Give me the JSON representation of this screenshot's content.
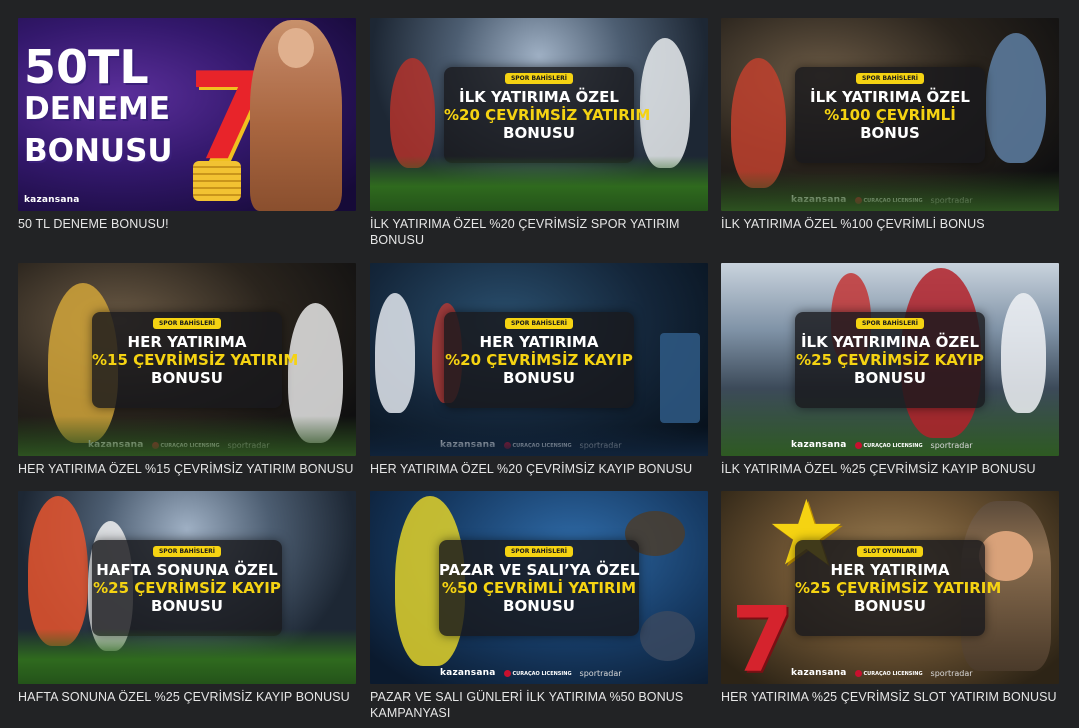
{
  "cards": [
    {
      "caption": "50 TL DENEME BONUSU!",
      "banner": {
        "style": "casino",
        "big_lines": [
          "50TL",
          "DENEME",
          "BONUSU"
        ],
        "footer_brand": "kazansana"
      }
    },
    {
      "caption": "İLK YATIRIMA ÖZEL %20 ÇEVRİMSİZ SPOR YATIRIM BONUSU",
      "banner": {
        "style": "sport",
        "tag": "SPOR BAHİSLERİ",
        "lines": [
          "İLK YATIRIMA ÖZEL",
          "%20 ÇEVRİMSİZ YATIRIM",
          "BONUSU"
        ],
        "footer_brand": "kazansana",
        "footer_license": "CURAÇAO LICENSING",
        "footer_partner": "sportradar"
      }
    },
    {
      "caption": "İLK YATIRIMA ÖZEL %100 ÇEVRİMLİ BONUS",
      "banner": {
        "style": "sport",
        "tag": "SPOR BAHİSLERİ",
        "lines": [
          "İLK YATIRIMA ÖZEL",
          "%100 ÇEVRİMLİ",
          "BONUS"
        ],
        "footer_brand": "kazansana",
        "footer_license": "CURAÇAO LICENSING",
        "footer_partner": "sportradar"
      }
    },
    {
      "caption": "HER YATIRIMA ÖZEL %15 ÇEVRİMSİZ YATIRIM BONUSU",
      "banner": {
        "style": "sport",
        "tag": "SPOR BAHİSLERİ",
        "lines": [
          "HER YATIRIMA",
          "%15 ÇEVRİMSİZ YATIRIM",
          "BONUSU"
        ],
        "footer_brand": "kazansana",
        "footer_license": "CURAÇAO LICENSING",
        "footer_partner": "sportradar"
      }
    },
    {
      "caption": "HER YATIRIMA ÖZEL %20 ÇEVRİMSİZ KAYIP BONUSU",
      "banner": {
        "style": "sport",
        "tag": "SPOR BAHİSLERİ",
        "lines": [
          "HER YATIRIMA",
          "%20 ÇEVRİMSİZ KAYIP",
          "BONUSU"
        ],
        "footer_brand": "kazansana",
        "footer_license": "CURAÇAO LICENSING",
        "footer_partner": "sportradar"
      }
    },
    {
      "caption": "İLK YATIRIMA ÖZEL %25 ÇEVRİMSİZ KAYIP BONUSU",
      "banner": {
        "style": "sport",
        "tag": "SPOR BAHİSLERİ",
        "lines": [
          "İLK YATIRIMINA ÖZEL",
          "%25 ÇEVRİMSİZ KAYIP",
          "BONUSU"
        ],
        "footer_brand": "kazansana",
        "footer_license": "CURAÇAO LICENSING",
        "footer_partner": "sportradar"
      }
    },
    {
      "caption": "HAFTA SONUNA ÖZEL %25 ÇEVRİMSİZ KAYIP BONUSU",
      "banner": {
        "style": "sport",
        "tag": "SPOR BAHİSLERİ",
        "lines": [
          "HAFTA SONUNA ÖZEL",
          "%25 ÇEVRİMSİZ KAYIP",
          "BONUSU"
        ],
        "footer_brand": "kazansana",
        "footer_license": "CURAÇAO LICENSING",
        "footer_partner": "sportradar"
      }
    },
    {
      "caption": "PAZAR VE SALI GÜNLERİ İLK YATIRIMA %50 BONUS KAMPANYASI",
      "banner": {
        "style": "sport",
        "tag": "SPOR BAHİSLERİ",
        "lines": [
          "PAZAR VE SALI’YA ÖZEL",
          "%50 ÇEVRİMLİ YATIRIM",
          "BONUSU"
        ],
        "footer_brand": "kazansana",
        "footer_license": "CURAÇAO LICENSING",
        "footer_partner": "sportradar"
      }
    },
    {
      "caption": "HER YATIRIMA %25 ÇEVRİMSİZ SLOT YATIRIM BONUSU",
      "banner": {
        "style": "slot",
        "tag": "SLOT OYUNLARI",
        "lines": [
          "HER YATIRIMA",
          "%25 ÇEVRİMSİZ YATIRIM",
          "BONUSU"
        ],
        "footer_brand": "kazansana",
        "footer_license": "CURAÇAO LICENSING",
        "footer_partner": "sportradar"
      }
    }
  ],
  "colors": {
    "page_bg": "#222325",
    "accent_yellow": "#f5d312",
    "caption_text": "#e6e6e6",
    "panel_bg": "#19191c"
  }
}
